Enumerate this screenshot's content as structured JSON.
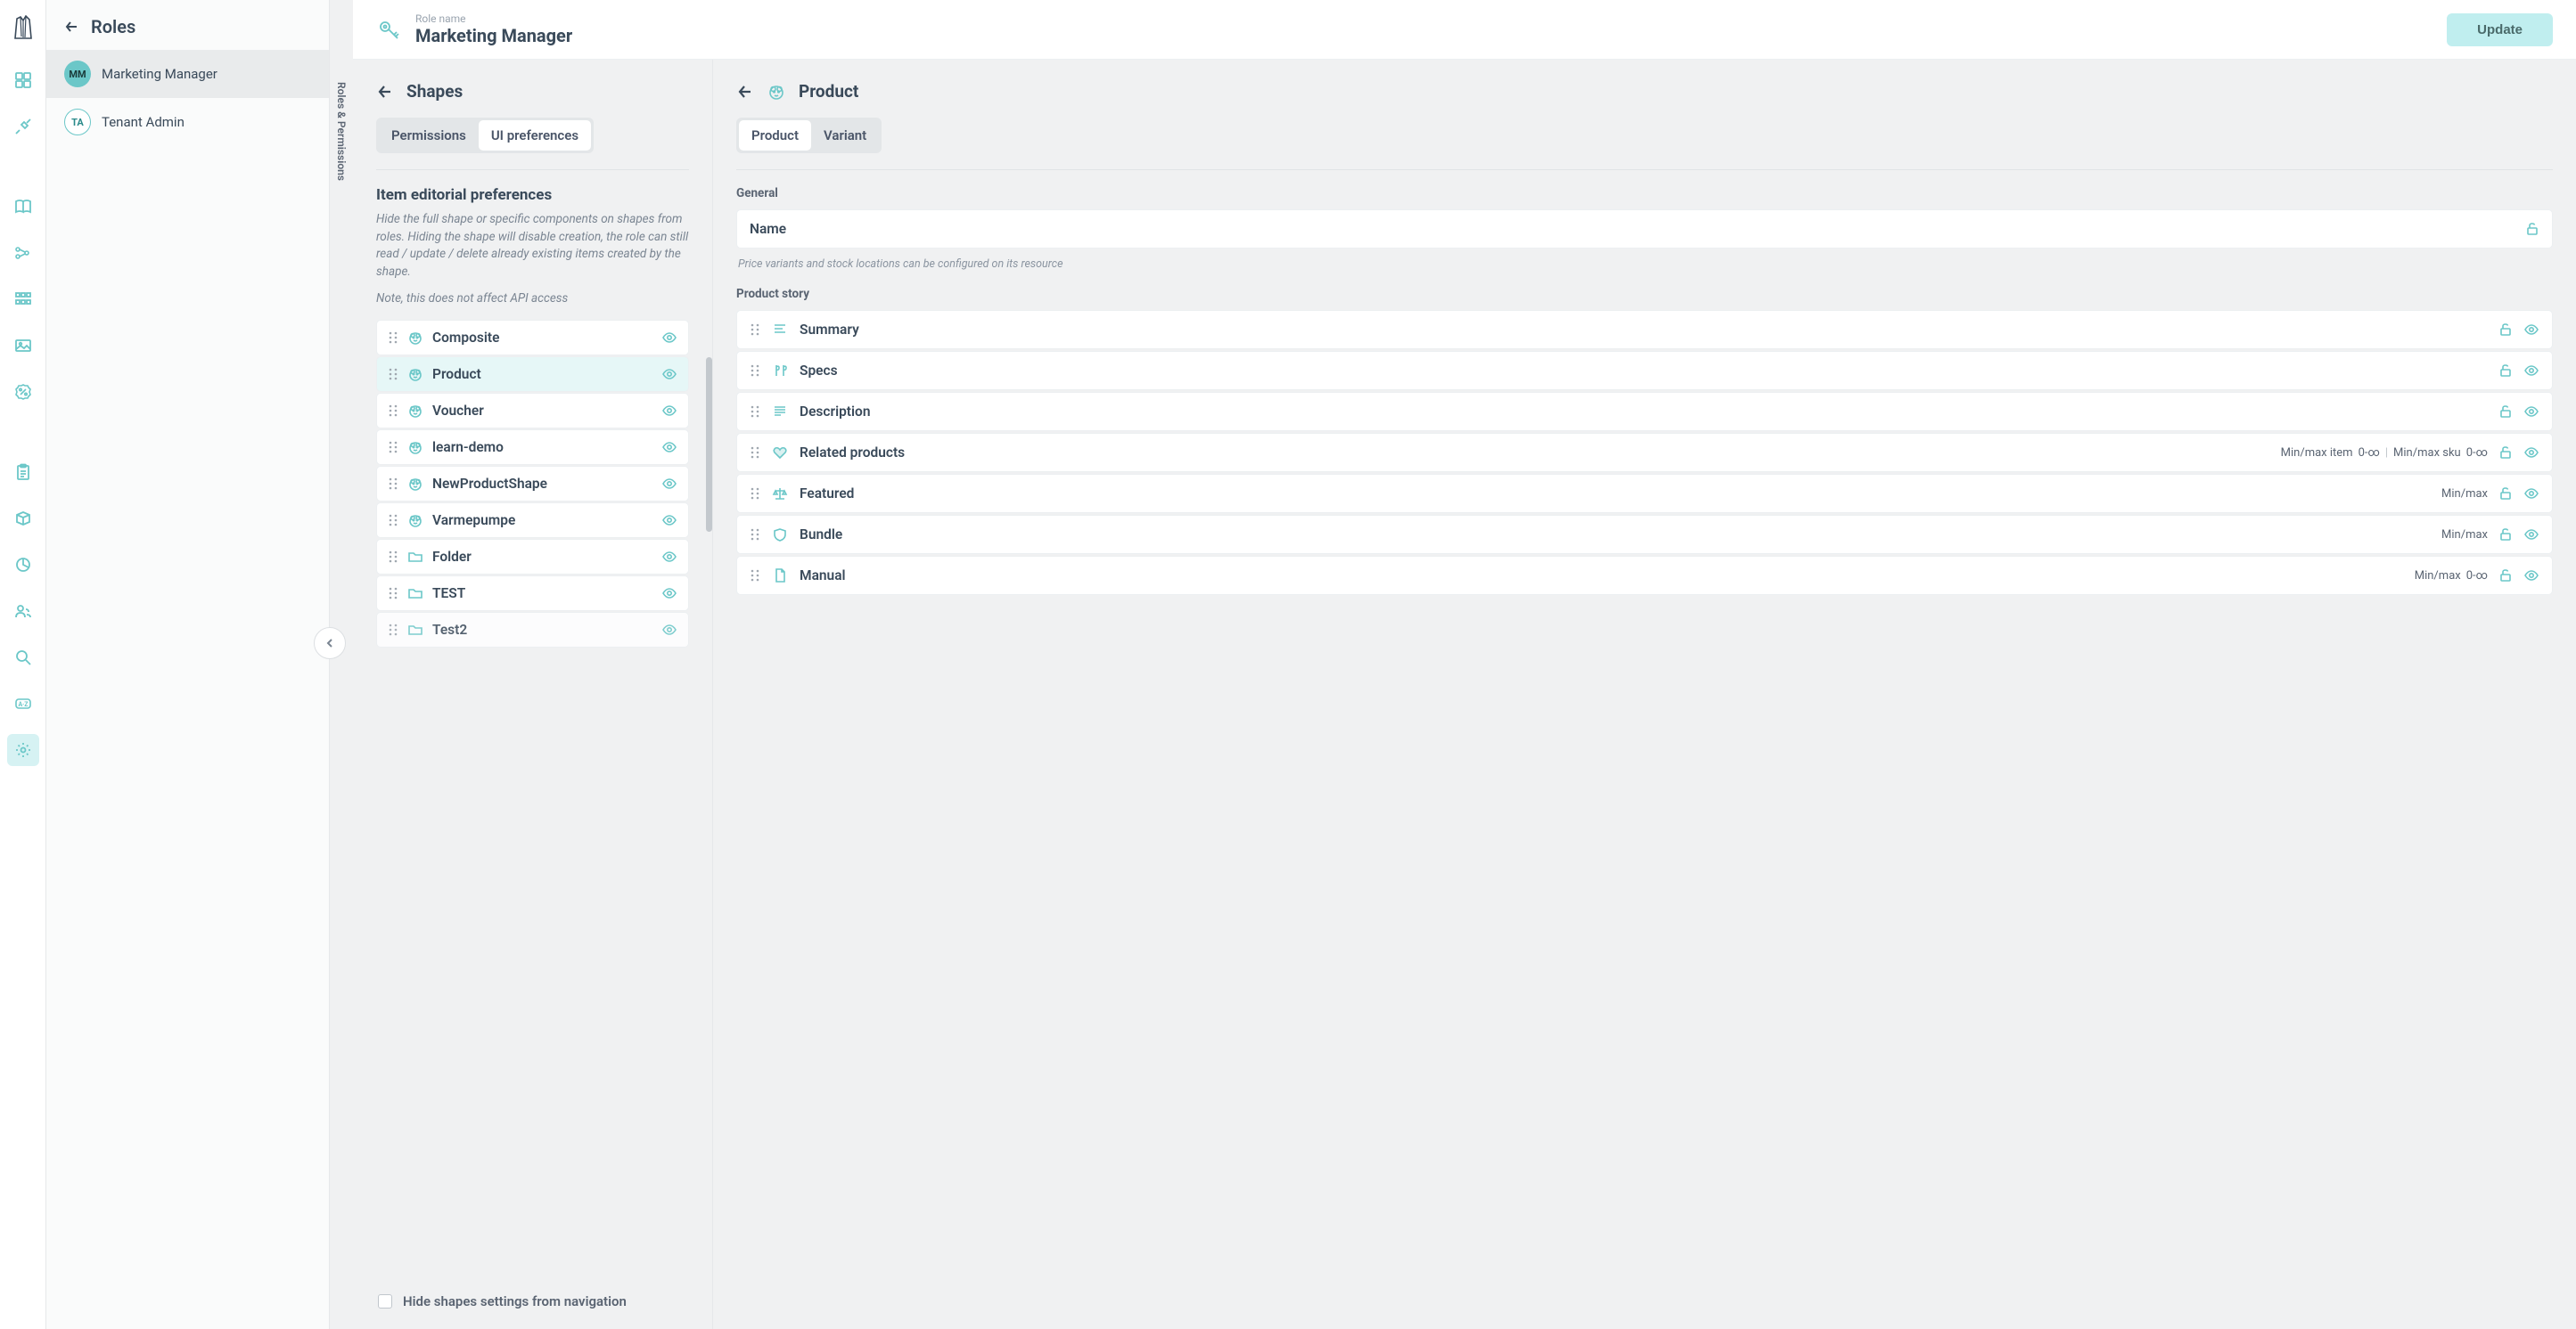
{
  "rolesSidebar": {
    "title": "Roles",
    "items": [
      {
        "initials": "MM",
        "label": "Marketing Manager"
      },
      {
        "initials": "TA",
        "label": "Tenant Admin"
      }
    ]
  },
  "verticalLabel": "Roles & Permissions",
  "header": {
    "label": "Role name",
    "title": "Marketing Manager",
    "updateBtn": "Update"
  },
  "shapesPanel": {
    "title": "Shapes",
    "tabs": {
      "permissions": "Permissions",
      "uiPrefs": "UI preferences"
    },
    "section": {
      "heading": "Item editorial preferences",
      "desc": "Hide the full shape or specific components on shapes from roles. Hiding the shape will disable creation, the role can still read / update / delete already existing items created by the shape.",
      "note": "Note, this does not affect API access"
    },
    "shapes": [
      {
        "name": "Composite",
        "icon": "product"
      },
      {
        "name": "Product",
        "icon": "product"
      },
      {
        "name": "Voucher",
        "icon": "product"
      },
      {
        "name": "learn-demo",
        "icon": "product"
      },
      {
        "name": "NewProductShape",
        "icon": "product"
      },
      {
        "name": "Varmepumpe",
        "icon": "product"
      },
      {
        "name": "Folder",
        "icon": "folder"
      },
      {
        "name": "TEST",
        "icon": "folder"
      },
      {
        "name": "Test2",
        "icon": "folder"
      }
    ],
    "hideShapesLabel": "Hide shapes settings from navigation"
  },
  "productPanel": {
    "title": "Product",
    "tabs": {
      "product": "Product",
      "variant": "Variant"
    },
    "generalLabel": "General",
    "general": [
      {
        "name": "Name"
      }
    ],
    "hint": "Price variants and stock locations can be configured on its resource",
    "storyLabel": "Product story",
    "story": [
      {
        "name": "Summary",
        "icon": "text",
        "meta": null
      },
      {
        "name": "Specs",
        "icon": "specs",
        "meta": null
      },
      {
        "name": "Description",
        "icon": "paragraph",
        "meta": null
      },
      {
        "name": "Related products",
        "icon": "heart",
        "metaParts": [
          "Min/max item",
          "0-∞",
          "Min/max sku",
          "0-∞"
        ]
      },
      {
        "name": "Featured",
        "icon": "scales",
        "metaSimple": "Min/max"
      },
      {
        "name": "Bundle",
        "icon": "shield",
        "metaSimple": "Min/max"
      },
      {
        "name": "Manual",
        "icon": "file",
        "metaParts": [
          "Min/max",
          "0-∞"
        ]
      }
    ]
  }
}
